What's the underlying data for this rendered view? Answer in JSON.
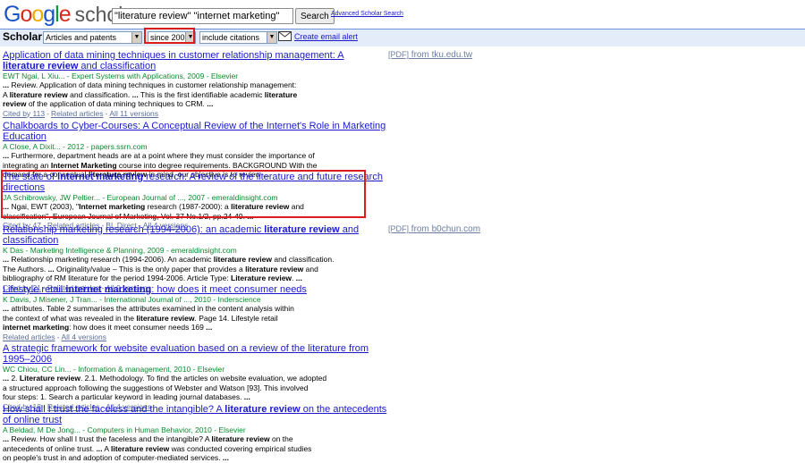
{
  "header": {
    "logo_letters": [
      "G",
      "o",
      "o",
      "g",
      "l",
      "e"
    ],
    "logo_word": "scholar",
    "query": "\"literature review\" \"internet marketing\"",
    "search_button": "Search",
    "advanced_link": "Advanced Scholar Search"
  },
  "bar": {
    "title": "Scholar",
    "doc_type": "Articles and patents",
    "date_filter": "since 2007",
    "citations_filter": "include citations",
    "alert_link": "Create email alert",
    "arrow": "▼"
  },
  "results": [
    {
      "title_html": "Application of data mining techniques in customer relationship management: A <b>literature review</b> and classification",
      "meta": "EWT Ngai, L Xiu... - Expert Systems with Applications, 2009 - Elsevier",
      "snippet_html": "<b>...</b> Review. Application of data mining techniques in customer relationship management:<br>A <b>literature review</b> and classification. <b>...</b> This is the first identifiable academic <b>literature</b><br><b>review</b> of the application of data mining techniques to CRM. <b>...</b>",
      "links": [
        "Cited by 113",
        "Related articles",
        "All 11 versions"
      ],
      "pdf_tag": "[PDF]",
      "pdf_source": "from tku.edu.tw"
    },
    {
      "title_html": "Chalkboards to Cyber-Courses: A Conceptual Review of the Internet's Role in Marketing Education",
      "meta": "A Close, A Dixit... - 2012 - papers.ssrn.com",
      "snippet_html": "<b>...</b> Furthermore, department heads are at a point where they must consider the importance of<br>integrating an <b>Internet Marketing</b> course into degree requirements. BACKGROUND With the<br>demand for a conceptual <b>literature review</b> in mind, our objective is to review <b>...</b>",
      "links": []
    },
    {
      "title_html": "The state of <b>internet marketing</b> research: A review of the literature and future research directions",
      "meta": "JA Schibrowsky, JW Peltier... - European Journal of ..., 2007 - emeraldinsight.com",
      "snippet_html": "<b>...</b> Ngai, EWT (2003), \"<b>Internet marketing</b> research (1987-2000): a <b>literature review</b> and<br>classification\", European Journal of Marketing, Vol. 37 No.1/2, pp.24-49. <b>...</b>",
      "links": [
        "Cited by 47",
        "Related articles",
        "BL Direct",
        "All 4 versions"
      ]
    },
    {
      "title_html": "Relationship marketing research (1994-2006): an academic <b>literature review</b> and classification",
      "meta": "K Das - Marketing Intelligence & Planning, 2009 - emeraldinsight.com",
      "snippet_html": "<b>...</b> Relationship marketing research (1994-2006). An academic <b>literature review</b> and classification.<br>The Authors. <b>...</b> Originality/value – This is the only paper that provides a <b>literature review</b> and<br>bibliography of RM literature for the period 1994-2006. Article Type: <b>Literature review</b>. <b>...</b>",
      "links": [
        "Cited by 21",
        "Related articles",
        "All 9 versions"
      ],
      "pdf_tag": "[PDF]",
      "pdf_source": "from b0chun.com"
    },
    {
      "title_html": "Lifestyle retail <b>internet marketing</b>: how does it meet consumer needs",
      "meta": "K Davis, J Misener, J Tran... - International Journal of ..., 2010 - Inderscience",
      "snippet_html": "<b>...</b> attributes. Table 2 summarises the attributes examined in the content analysis within<br>the context of what was revealed in the <b>literature review</b>. Page 14. Lifestyle retail<br><b>internet marketing</b>: how does it meet consumer needs 169 <b>...</b>",
      "links": [
        "Related articles",
        "All 4 versions"
      ]
    },
    {
      "title_html": "A strategic framework for website evaluation based on a review of the literature from 1995–2006",
      "meta": "WC Chiou, CC Lin... - Information & management, 2010 - Elsevier",
      "snippet_html": "<b>...</b> 2. <b>Literature review</b>. 2.1. Methodology. To find the articles on website evaluation, we adopted<br>a structured approach following the suggestions of Webster and Watson [93]. This involved<br>four steps: 1. Search a particular keyword in leading journal databases. <b>...</b>",
      "links": [
        "Cited by 18",
        "Related articles",
        "All 4 versions"
      ]
    },
    {
      "title_html": "How shall I trust the faceless and the intangible? A <b>literature review</b> on the antecedents of online trust",
      "meta": "A Beldad, M De Jong... - Computers in Human Behavior, 2010 - Elsevier",
      "snippet_html": "<b>...</b> Review. How shall I trust the faceless and the intangible? A <b>literature review</b> on the<br>antecedents of online trust. <b>...</b> A <b>literature review</b> was conducted covering empirical studies<br>on people's trust in and adoption of computer-mediated services. <b>...</b>",
      "links": []
    }
  ]
}
